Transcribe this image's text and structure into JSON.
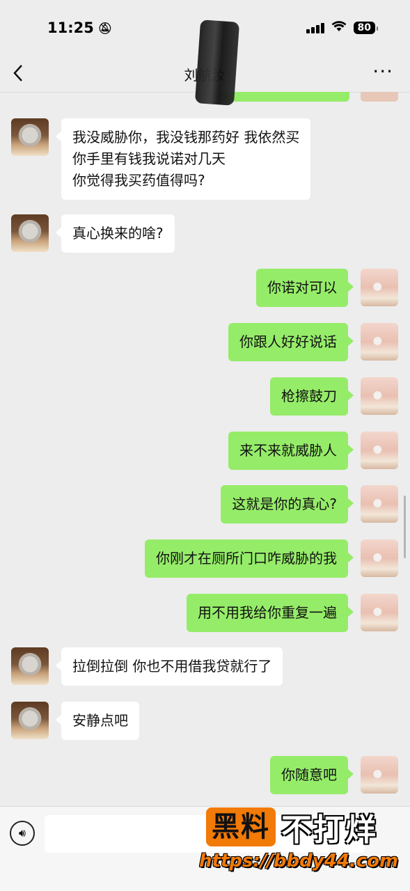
{
  "status_bar": {
    "time": "11:25",
    "mute_icon": "bell-slash-icon",
    "battery": "80"
  },
  "header": {
    "back_icon": "chevron-left-icon",
    "title": "刘航汝",
    "more_icon": "more-dots-icon",
    "more_label": "···"
  },
  "messages": [
    {
      "side": "left",
      "text": "我没威胁你，我没钱那药好 我依然买\n你手里有钱我说诺对几天\n你觉得我买药值得吗?"
    },
    {
      "side": "left",
      "text": "真心换来的啥?"
    },
    {
      "side": "right",
      "text": "你诺对可以"
    },
    {
      "side": "right",
      "text": "你跟人好好说话"
    },
    {
      "side": "right",
      "text": "枪擦鼓刀"
    },
    {
      "side": "right",
      "text": "来不来就威胁人"
    },
    {
      "side": "right",
      "text": "这就是你的真心?"
    },
    {
      "side": "right",
      "text": "你刚才在厕所门口咋威胁的我"
    },
    {
      "side": "right",
      "text": "用不用我给你重复一遍"
    },
    {
      "side": "left",
      "text": "拉倒拉倒 你也不用借我贷就行了"
    },
    {
      "side": "left",
      "text": "安静点吧"
    },
    {
      "side": "right",
      "text": "你随意吧"
    }
  ],
  "input_bar": {
    "voice_icon": "voice-icon",
    "voice_glyph": "🔊︎"
  },
  "watermark": {
    "badge": "黑料",
    "text": "不打烊",
    "url": "https://bbdy44.com"
  }
}
